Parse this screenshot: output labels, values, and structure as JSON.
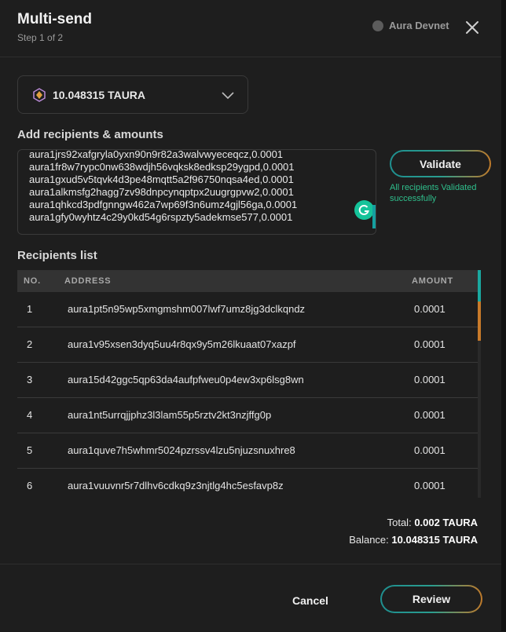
{
  "header": {
    "title": "Multi-send",
    "subtitle": "Step 1 of 2",
    "network": "Aura Devnet"
  },
  "token": {
    "balance": "10.048315 TAURA",
    "icon": "aura-token-icon"
  },
  "recipients_input": {
    "label": "Add recipients & amounts",
    "lines": [
      "aura1jrs92xafgryla0yxn90n9r82a3walvwyeceqcz,0.0001",
      "aura1fr8w7rypc0nw638wdjh56vqksk8edksp29ygpd,0.0001",
      "aura1gxud5v5tqvk4d3pe48mqtt5a2f96750nqsa4ed,0.0001",
      "aura1alkmsfg2hagg7zv98dnpcynqptpx2uugrgpvw2,0.0001",
      "aura1qhkcd3pdfgnngw462a7wp69f3n6umz4gjl56ga,0.0001",
      "aura1gfy0wyhtz4c29y0kd54g6rspzty5adekmse577,0.0001"
    ]
  },
  "validate": {
    "label": "Validate",
    "message": "All recipients Validated successfully"
  },
  "recipients_list": {
    "label": "Recipients list",
    "columns": [
      "NO.",
      "ADDRESS",
      "AMOUNT"
    ],
    "rows": [
      {
        "no": "1",
        "address": "aura1pt5n95wp5xmgmshm007lwf7umz8jg3dclkqndz",
        "amount": "0.0001"
      },
      {
        "no": "2",
        "address": "aura1v95xsen3dyq5uu4r8qx9y5m26lkuaat07xazpf",
        "amount": "0.0001"
      },
      {
        "no": "3",
        "address": "aura15d42ggc5qp63da4aufpfweu0p4ew3xp6lsg8wn",
        "amount": "0.0001"
      },
      {
        "no": "4",
        "address": "aura1nt5urrqjjphz3l3lam55p5rztv2kt3nzjffg0p",
        "amount": "0.0001"
      },
      {
        "no": "5",
        "address": "aura1quve7h5whmr5024pzrssv4lzu5njuzsnuxhre8",
        "amount": "0.0001"
      },
      {
        "no": "6",
        "address": "aura1vuuvnr5r7dlhv6cdkq9z3njtlg4hc5esfavp8z",
        "amount": "0.0001"
      }
    ]
  },
  "summary": {
    "total_label": "Total:",
    "total_value": "0.002 TAURA",
    "balance_label": "Balance:",
    "balance_value": "10.048315 TAURA"
  },
  "footer": {
    "cancel": "Cancel",
    "review": "Review"
  },
  "colors": {
    "accent_teal": "#1f8f8f",
    "accent_orange": "#c07a2a",
    "success_green": "#2fbf8c"
  }
}
